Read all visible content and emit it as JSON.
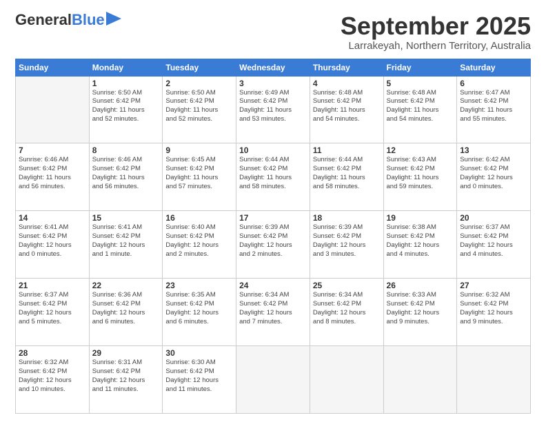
{
  "logo": {
    "part1": "General",
    "part2": "Blue"
  },
  "title": "September 2025",
  "subtitle": "Larrakeyah, Northern Territory, Australia",
  "days_header": [
    "Sunday",
    "Monday",
    "Tuesday",
    "Wednesday",
    "Thursday",
    "Friday",
    "Saturday"
  ],
  "weeks": [
    [
      {
        "num": "",
        "info": ""
      },
      {
        "num": "1",
        "info": "Sunrise: 6:50 AM\nSunset: 6:42 PM\nDaylight: 11 hours\nand 52 minutes."
      },
      {
        "num": "2",
        "info": "Sunrise: 6:50 AM\nSunset: 6:42 PM\nDaylight: 11 hours\nand 52 minutes."
      },
      {
        "num": "3",
        "info": "Sunrise: 6:49 AM\nSunset: 6:42 PM\nDaylight: 11 hours\nand 53 minutes."
      },
      {
        "num": "4",
        "info": "Sunrise: 6:48 AM\nSunset: 6:42 PM\nDaylight: 11 hours\nand 54 minutes."
      },
      {
        "num": "5",
        "info": "Sunrise: 6:48 AM\nSunset: 6:42 PM\nDaylight: 11 hours\nand 54 minutes."
      },
      {
        "num": "6",
        "info": "Sunrise: 6:47 AM\nSunset: 6:42 PM\nDaylight: 11 hours\nand 55 minutes."
      }
    ],
    [
      {
        "num": "7",
        "info": "Sunrise: 6:46 AM\nSunset: 6:42 PM\nDaylight: 11 hours\nand 56 minutes."
      },
      {
        "num": "8",
        "info": "Sunrise: 6:46 AM\nSunset: 6:42 PM\nDaylight: 11 hours\nand 56 minutes."
      },
      {
        "num": "9",
        "info": "Sunrise: 6:45 AM\nSunset: 6:42 PM\nDaylight: 11 hours\nand 57 minutes."
      },
      {
        "num": "10",
        "info": "Sunrise: 6:44 AM\nSunset: 6:42 PM\nDaylight: 11 hours\nand 58 minutes."
      },
      {
        "num": "11",
        "info": "Sunrise: 6:44 AM\nSunset: 6:42 PM\nDaylight: 11 hours\nand 58 minutes."
      },
      {
        "num": "12",
        "info": "Sunrise: 6:43 AM\nSunset: 6:42 PM\nDaylight: 11 hours\nand 59 minutes."
      },
      {
        "num": "13",
        "info": "Sunrise: 6:42 AM\nSunset: 6:42 PM\nDaylight: 12 hours\nand 0 minutes."
      }
    ],
    [
      {
        "num": "14",
        "info": "Sunrise: 6:41 AM\nSunset: 6:42 PM\nDaylight: 12 hours\nand 0 minutes."
      },
      {
        "num": "15",
        "info": "Sunrise: 6:41 AM\nSunset: 6:42 PM\nDaylight: 12 hours\nand 1 minute."
      },
      {
        "num": "16",
        "info": "Sunrise: 6:40 AM\nSunset: 6:42 PM\nDaylight: 12 hours\nand 2 minutes."
      },
      {
        "num": "17",
        "info": "Sunrise: 6:39 AM\nSunset: 6:42 PM\nDaylight: 12 hours\nand 2 minutes."
      },
      {
        "num": "18",
        "info": "Sunrise: 6:39 AM\nSunset: 6:42 PM\nDaylight: 12 hours\nand 3 minutes."
      },
      {
        "num": "19",
        "info": "Sunrise: 6:38 AM\nSunset: 6:42 PM\nDaylight: 12 hours\nand 4 minutes."
      },
      {
        "num": "20",
        "info": "Sunrise: 6:37 AM\nSunset: 6:42 PM\nDaylight: 12 hours\nand 4 minutes."
      }
    ],
    [
      {
        "num": "21",
        "info": "Sunrise: 6:37 AM\nSunset: 6:42 PM\nDaylight: 12 hours\nand 5 minutes."
      },
      {
        "num": "22",
        "info": "Sunrise: 6:36 AM\nSunset: 6:42 PM\nDaylight: 12 hours\nand 6 minutes."
      },
      {
        "num": "23",
        "info": "Sunrise: 6:35 AM\nSunset: 6:42 PM\nDaylight: 12 hours\nand 6 minutes."
      },
      {
        "num": "24",
        "info": "Sunrise: 6:34 AM\nSunset: 6:42 PM\nDaylight: 12 hours\nand 7 minutes."
      },
      {
        "num": "25",
        "info": "Sunrise: 6:34 AM\nSunset: 6:42 PM\nDaylight: 12 hours\nand 8 minutes."
      },
      {
        "num": "26",
        "info": "Sunrise: 6:33 AM\nSunset: 6:42 PM\nDaylight: 12 hours\nand 9 minutes."
      },
      {
        "num": "27",
        "info": "Sunrise: 6:32 AM\nSunset: 6:42 PM\nDaylight: 12 hours\nand 9 minutes."
      }
    ],
    [
      {
        "num": "28",
        "info": "Sunrise: 6:32 AM\nSunset: 6:42 PM\nDaylight: 12 hours\nand 10 minutes."
      },
      {
        "num": "29",
        "info": "Sunrise: 6:31 AM\nSunset: 6:42 PM\nDaylight: 12 hours\nand 11 minutes."
      },
      {
        "num": "30",
        "info": "Sunrise: 6:30 AM\nSunset: 6:42 PM\nDaylight: 12 hours\nand 11 minutes."
      },
      {
        "num": "",
        "info": ""
      },
      {
        "num": "",
        "info": ""
      },
      {
        "num": "",
        "info": ""
      },
      {
        "num": "",
        "info": ""
      }
    ]
  ]
}
